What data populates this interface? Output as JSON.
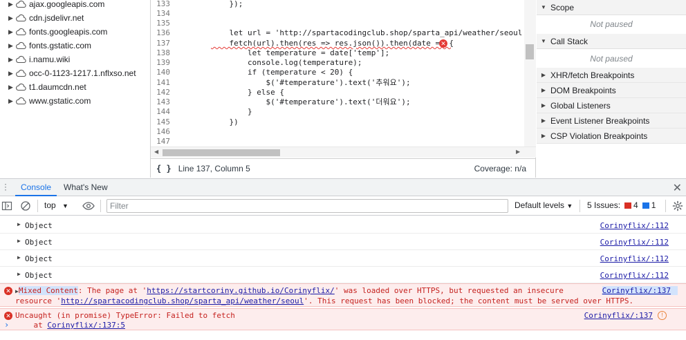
{
  "file_tree": {
    "items": [
      {
        "label": "ajax.googleapis.com"
      },
      {
        "label": "cdn.jsdelivr.net"
      },
      {
        "label": "fonts.googleapis.com"
      },
      {
        "label": "fonts.gstatic.com"
      },
      {
        "label": "i.namu.wiki"
      },
      {
        "label": "occ-0-1123-1217.1.nflxso.net"
      },
      {
        "label": "t1.daumcdn.net"
      },
      {
        "label": "www.gstatic.com"
      }
    ]
  },
  "editor": {
    "lines": [
      {
        "num": "133",
        "code": "    });"
      },
      {
        "num": "134",
        "code": ""
      },
      {
        "num": "135",
        "code": ""
      },
      {
        "num": "136",
        "code": "    let url = 'http://spartacodingclub.shop/sparta_api/weather/seoul';"
      },
      {
        "num": "137",
        "code": "    fetch(url).then(res => res.json()).then(date => {"
      },
      {
        "num": "138",
        "code": "        let temperature = date['temp'];"
      },
      {
        "num": "139",
        "code": "        console.log(temperature);"
      },
      {
        "num": "140",
        "code": "        if (temperature < 20) {"
      },
      {
        "num": "141",
        "code": "            $('#temperature').text('추워요');"
      },
      {
        "num": "142",
        "code": "        } else {"
      },
      {
        "num": "143",
        "code": "            $('#temperature').text('더워요');"
      },
      {
        "num": "144",
        "code": "        }"
      },
      {
        "num": "145",
        "code": "    })"
      },
      {
        "num": "146",
        "code": ""
      },
      {
        "num": "147",
        "code": ""
      }
    ],
    "error_badge": "✕",
    "status": {
      "position": "Line 137, Column 5",
      "coverage": "Coverage: n/a",
      "braces_icon": "{ }"
    }
  },
  "debugger": {
    "scope_label": "Scope",
    "scope_note": "Not paused",
    "callstack_label": "Call Stack",
    "callstack_note": "Not paused",
    "breakpoints": [
      {
        "label": "XHR/fetch Breakpoints"
      },
      {
        "label": "DOM Breakpoints"
      },
      {
        "label": "Global Listeners"
      },
      {
        "label": "Event Listener Breakpoints"
      },
      {
        "label": "CSP Violation Breakpoints"
      }
    ]
  },
  "drawer": {
    "tabs": [
      {
        "label": "Console",
        "active": true
      },
      {
        "label": "What's New",
        "active": false
      }
    ],
    "close_icon": "✕"
  },
  "console_toolbar": {
    "context": "top",
    "filter_placeholder": "Filter",
    "levels": "Default levels",
    "issues_label": "5 Issues:",
    "issues_errors": "4",
    "issues_info": "1"
  },
  "console": {
    "objects": [
      {
        "text": "Object",
        "source": "Corinyflix/:112"
      },
      {
        "text": "Object",
        "source": "Corinyflix/:112"
      },
      {
        "text": "Object",
        "source": "Corinyflix/:112"
      },
      {
        "text": "Object",
        "source": "Corinyflix/:112"
      }
    ],
    "mixed": {
      "title": "Mixed Content",
      "part1": ": The page at '",
      "url1": "https://startcoriny.github.io/Corinyflix/",
      "part2": "' was loaded over HTTPS, but requested an insecure",
      "part3": "resource '",
      "url2": "http://spartacodingclub.shop/sparta_api/weather/seoul",
      "part4": "'. This request has been blocked; the content must be served over HTTPS.",
      "source": "Corinyflix/:137"
    },
    "uncaught": {
      "line1": "Uncaught (in promise) TypeError: Failed to fetch",
      "at_prefix": "    at ",
      "at_link": "Corinyflix/:137:5",
      "source": "Corinyflix/:137"
    },
    "prompt": "›"
  },
  "colors": {
    "accent": "#1a73e8",
    "error": "#d93025",
    "error_bg": "#fdeded"
  }
}
